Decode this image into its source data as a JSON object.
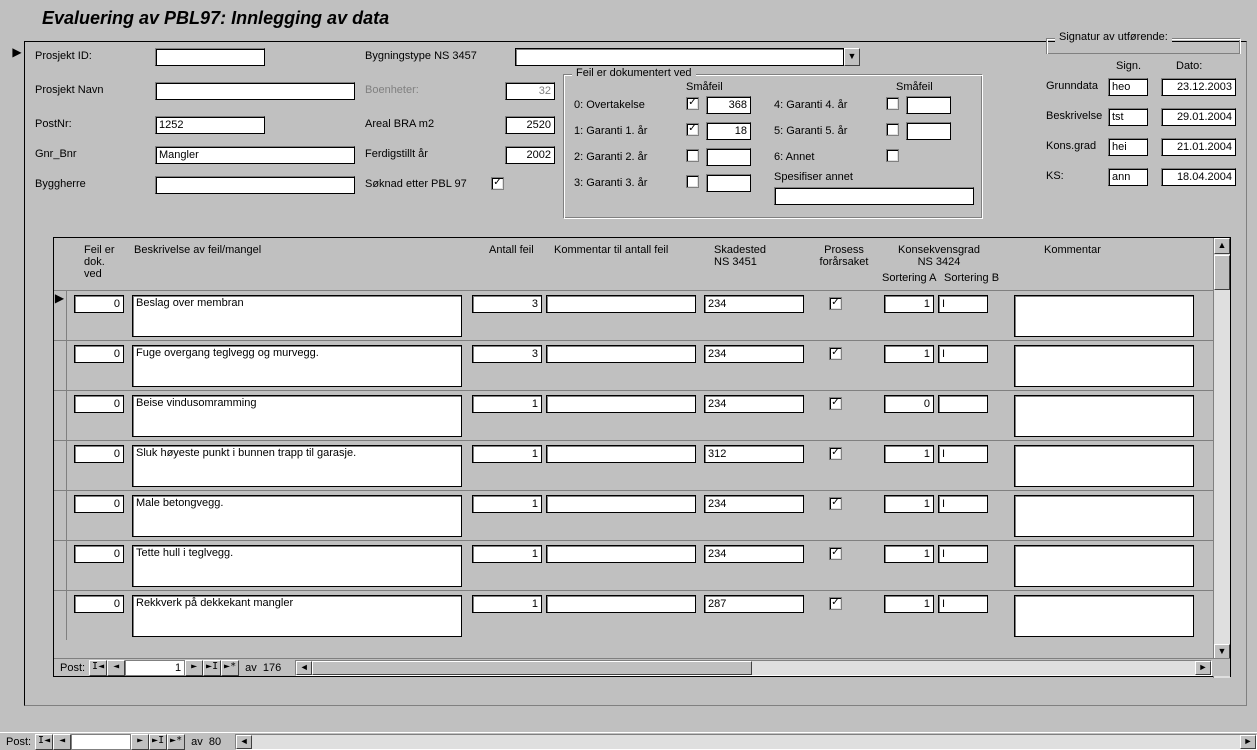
{
  "window": {
    "title": "Evaluering av PBL97: Innlegging av data"
  },
  "labels": {
    "prosjekt_id": "Prosjekt ID:",
    "prosjekt_navn": "Prosjekt Navn",
    "postnr": "PostNr:",
    "gnr_bnr": "Gnr_Bnr",
    "byggherre": "Byggherre",
    "bygningstype": "Bygningstype NS 3457",
    "boenheter": "Boenheter:",
    "areal": "Areal BRA m2",
    "ferdigstilt": "Ferdigstillt år",
    "soknad": "Søknad etter PBL 97",
    "feil_group": "Feil er dokumentert ved",
    "smaafeil": "Småfeil",
    "smaafeil2": "Småfeil",
    "f0": "0: Overtakelse",
    "f1": "1: Garanti 1. år",
    "f2": "2: Garanti 2. år",
    "f3": "3: Garanti 3. år",
    "f4": "4: Garanti 4. år",
    "f5": "5: Garanti 5. år",
    "f6": "6: Annet",
    "spesifiser": "Spesifiser annet",
    "sig_group": "Signatur av utførende:",
    "sign": "Sign.",
    "dato": "Dato:",
    "grunndata": "Grunndata",
    "beskrivelse": "Beskrivelse",
    "konsgrad": "Kons.grad",
    "ks": "KS:",
    "post": "Post:",
    "av": "av"
  },
  "fields": {
    "prosjekt_id": "",
    "prosjekt_navn": "",
    "postnr": "1252",
    "gnr_bnr": "Mangler",
    "byggherre": "",
    "bygningstype": "",
    "boenheter": "32",
    "areal": "2520",
    "ferdigstilt": "2002",
    "soknad_checked": true,
    "f0_checked": true,
    "f0_val": "368",
    "f1_checked": true,
    "f1_val": "18",
    "f2_checked": false,
    "f2_val": "",
    "f3_checked": false,
    "f3_val": "",
    "f4_checked": false,
    "f4_val": "",
    "f5_checked": false,
    "f5_val": "",
    "f6_checked": false,
    "f6_val": "",
    "spesifiser": ""
  },
  "sig": {
    "grunndata_sign": "heo",
    "grunndata_dato": "23.12.2003",
    "beskrivelse_sign": "tst",
    "beskrivelse_dato": "29.01.2004",
    "konsgrad_sign": "hei",
    "konsgrad_dato": "21.01.2004",
    "ks_sign": "ann",
    "ks_dato": "18.04.2004"
  },
  "subform": {
    "headers": {
      "feil_dok_ved": "Feil er dok. ved",
      "beskrivelse": "Beskrivelse av feil/mangel",
      "antall": "Antall feil",
      "kommentar_antall": "Kommentar til antall feil",
      "skadested": "Skadested NS 3451",
      "prosess": "Prosess forårsaket",
      "konsekvensgrad": "Konsekvensgrad NS 3424",
      "sort_a": "Sortering A",
      "sort_b": "Sortering B",
      "kommentar": "Kommentar"
    },
    "rows": [
      {
        "feil_dok": "0",
        "beskr": "Beslag over membran",
        "antall": "3",
        "komm_ant": "",
        "skade": "234",
        "prosess": true,
        "sort_a": "1",
        "sort_b": "I",
        "komm": ""
      },
      {
        "feil_dok": "0",
        "beskr": "Fuge overgang teglvegg og murvegg.",
        "antall": "3",
        "komm_ant": "",
        "skade": "234",
        "prosess": true,
        "sort_a": "1",
        "sort_b": "I",
        "komm": ""
      },
      {
        "feil_dok": "0",
        "beskr": "Beise vindusomramming",
        "antall": "1",
        "komm_ant": "",
        "skade": "234",
        "prosess": true,
        "sort_a": "0",
        "sort_b": "",
        "komm": ""
      },
      {
        "feil_dok": "0",
        "beskr": "Sluk høyeste punkt i bunnen trapp til garasje.",
        "antall": "1",
        "komm_ant": "",
        "skade": "312",
        "prosess": true,
        "sort_a": "1",
        "sort_b": "I",
        "komm": ""
      },
      {
        "feil_dok": "0",
        "beskr": "Male betongvegg.",
        "antall": "1",
        "komm_ant": "",
        "skade": "234",
        "prosess": true,
        "sort_a": "1",
        "sort_b": "I",
        "komm": ""
      },
      {
        "feil_dok": "0",
        "beskr": "Tette hull i teglvegg.",
        "antall": "1",
        "komm_ant": "",
        "skade": "234",
        "prosess": true,
        "sort_a": "1",
        "sort_b": "I",
        "komm": ""
      },
      {
        "feil_dok": "0",
        "beskr": "Rekkverk på dekkekant mangler",
        "antall": "1",
        "komm_ant": "",
        "skade": "287",
        "prosess": true,
        "sort_a": "1",
        "sort_b": "I",
        "komm": ""
      }
    ],
    "nav": {
      "current": "1",
      "total": "176"
    }
  },
  "outer_nav": {
    "current": "",
    "total": "80"
  }
}
